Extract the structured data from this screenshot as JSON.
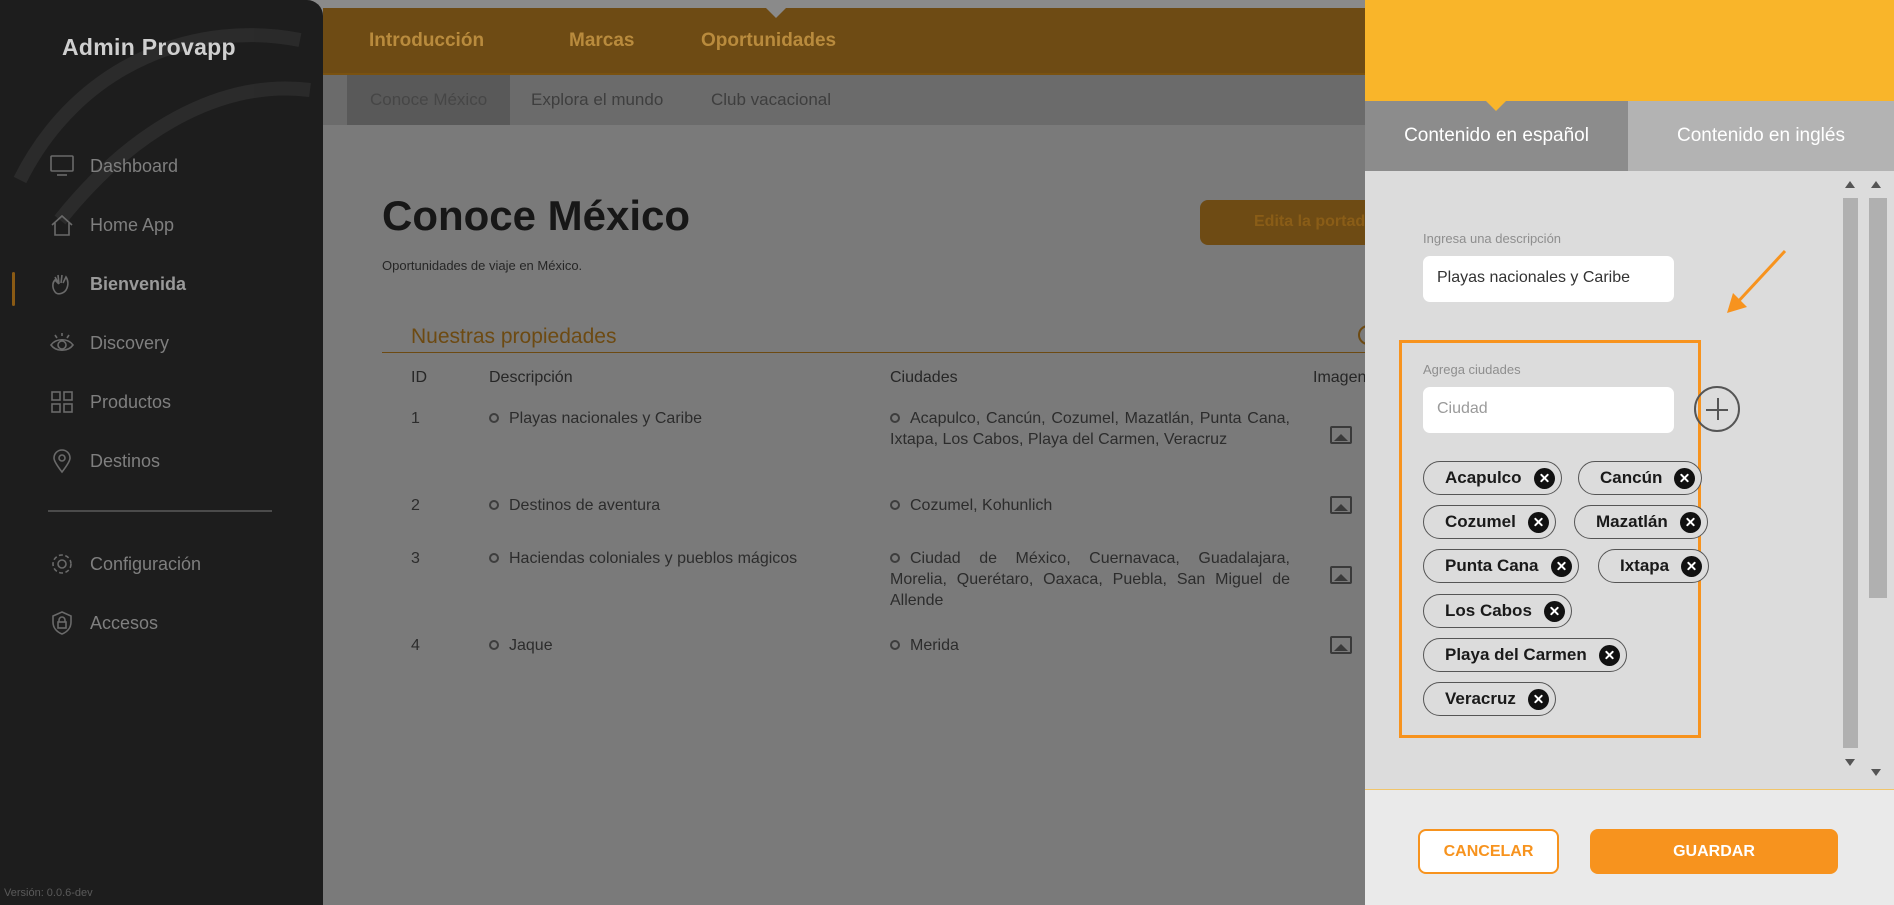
{
  "sidebar": {
    "brand": "Admin Provapp",
    "items": [
      {
        "label": "Dashboard",
        "icon": "monitor-icon"
      },
      {
        "label": "Home App",
        "icon": "home-icon"
      },
      {
        "label": "Bienvenida",
        "icon": "wave-hand-icon",
        "active": true
      },
      {
        "label": "Discovery",
        "icon": "eye-icon"
      },
      {
        "label": "Productos",
        "icon": "grid-icon"
      },
      {
        "label": "Destinos",
        "icon": "location-pin-icon"
      }
    ],
    "bottom_items": [
      {
        "label": "Configuración",
        "icon": "gear-icon"
      },
      {
        "label": "Accesos",
        "icon": "shield-lock-icon"
      }
    ],
    "version": "Versión: 0.0.6-dev"
  },
  "topnav": {
    "tabs": [
      "Introducción",
      "Marcas",
      "Oportunidades"
    ],
    "active": "Oportunidades"
  },
  "subnav": {
    "tabs": [
      "Conoce México",
      "Explora el mundo",
      "Club vacacional"
    ],
    "active": "Conoce México"
  },
  "main": {
    "title": "Conoce México",
    "subtitle": "Oportunidades de viaje en México.",
    "edit_button": "Edita la portada",
    "section_title": "Nuestras propiedades",
    "table": {
      "headers": [
        "ID",
        "Descripción",
        "Ciudades",
        "Imagen"
      ],
      "rows": [
        {
          "id": "1",
          "descripcion": "Playas nacionales y Caribe",
          "ciudades": "Acapulco, Cancún, Cozumel, Mazatlán, Punta Cana, Ixtapa, Los Cabos, Playa del Carmen, Veracruz"
        },
        {
          "id": "2",
          "descripcion": "Destinos de aventura",
          "ciudades": "Cozumel, Kohunlich"
        },
        {
          "id": "3",
          "descripcion": "Haciendas coloniales y pueblos mágicos",
          "ciudades": "Ciudad de México, Cuernavaca, Guadalajara, Morelia, Querétaro, Oaxaca, Puebla, San Miguel de Allende"
        },
        {
          "id": "4",
          "descripcion": "Jaque",
          "ciudades": "Merida"
        }
      ]
    }
  },
  "drawer": {
    "tabs": [
      "Contenido en español",
      "Contenido en inglés"
    ],
    "active_tab": "Contenido en español",
    "description_label": "Ingresa una descripción",
    "description_value": "Playas nacionales y Caribe",
    "cities_label": "Agrega ciudades",
    "city_placeholder": "Ciudad",
    "cities": [
      "Acapulco",
      "Cancún",
      "Cozumel",
      "Mazatlán",
      "Punta Cana",
      "Ixtapa",
      "Los Cabos",
      "Playa del Carmen",
      "Veracruz"
    ],
    "cancel_label": "CANCELAR",
    "save_label": "GUARDAR"
  },
  "colors": {
    "accent": "#f7931e",
    "header_yellow": "#f9b52a",
    "highlight_border": "#f7931e"
  }
}
